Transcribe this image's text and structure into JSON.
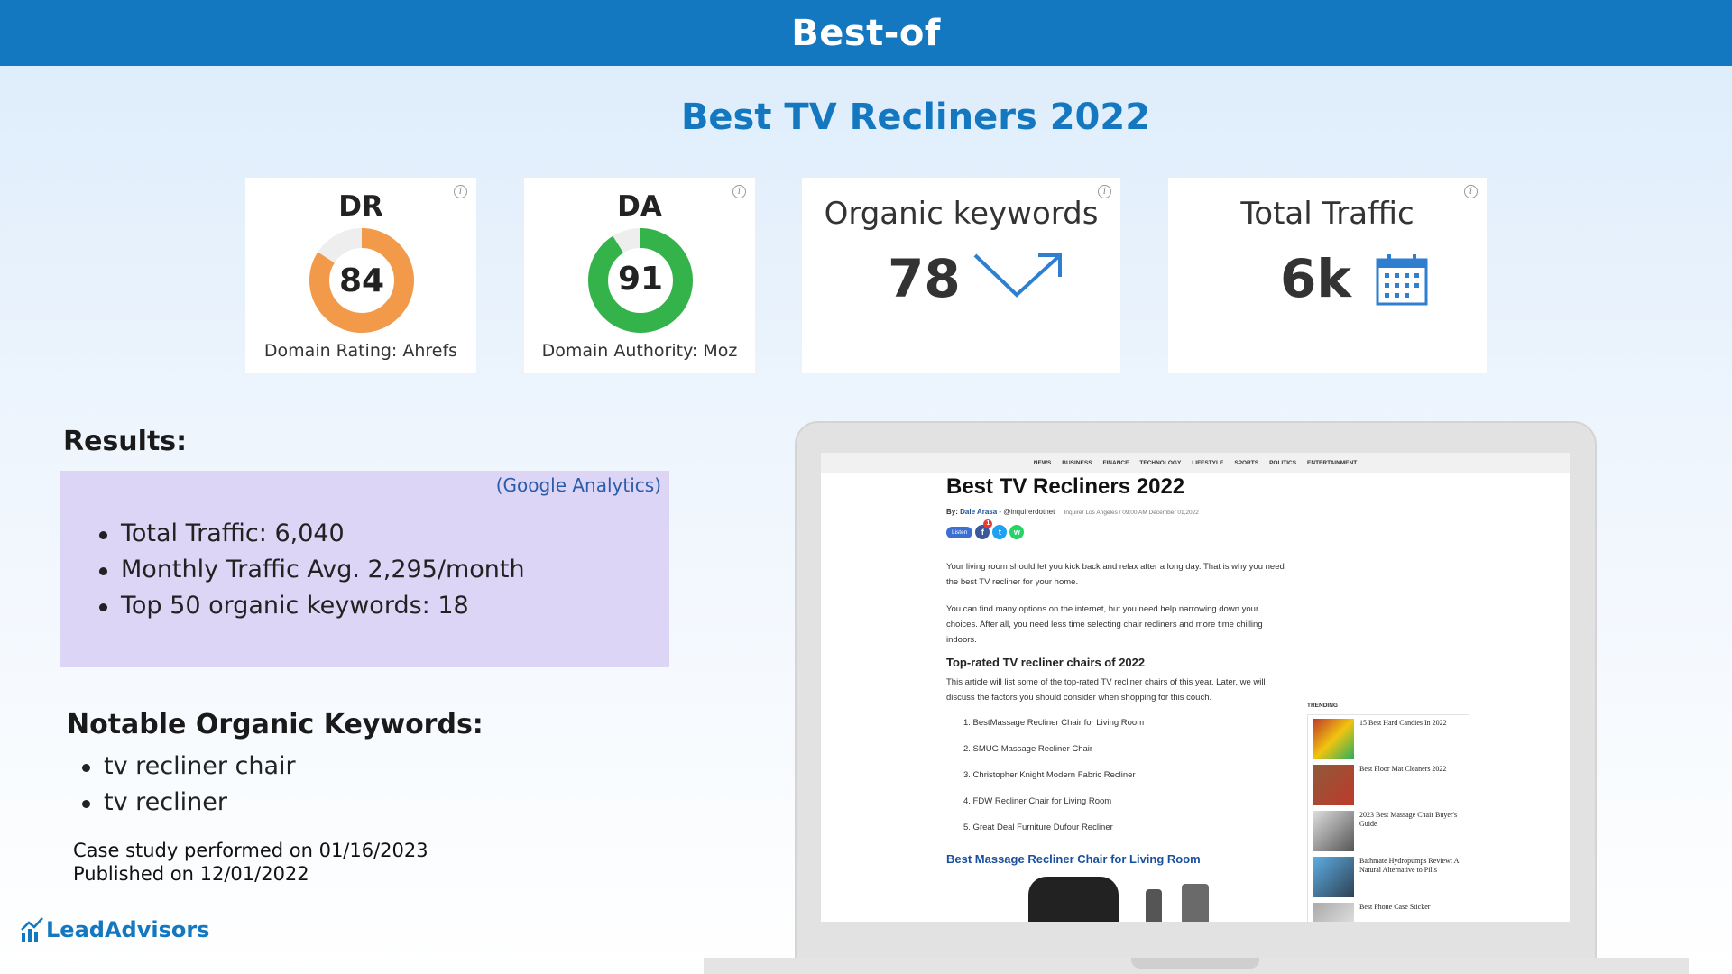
{
  "header": {
    "title": "Best-of"
  },
  "case_title": "Best TV Recliners 2022",
  "metrics": {
    "dr": {
      "label": "DR",
      "value": "84",
      "percent": 84,
      "caption": "Domain Rating: Ahrefs",
      "color": "#f2994a"
    },
    "da": {
      "label": "DA",
      "value": "91",
      "percent": 91,
      "caption": "Domain Authority: Moz",
      "color": "#34b34a"
    },
    "keywords": {
      "label": "Organic keywords",
      "value": "78",
      "icon": "trend-up-icon"
    },
    "traffic": {
      "label": "Total Traffic",
      "value": "6k",
      "icon": "calendar-icon"
    },
    "info_glyph": "i"
  },
  "results": {
    "heading": "Results:",
    "source": "(Google Analytics)",
    "items": [
      "Total Traffic: 6,040",
      "Monthly Traffic Avg. 2,295/month",
      "Top 50 organic keywords: 18"
    ]
  },
  "keywords": {
    "heading": "Notable Organic Keywords:",
    "items": [
      "tv recliner chair",
      "tv recliner"
    ]
  },
  "footnote": {
    "performed": "Case study performed on 01/16/2023",
    "published": "Published on 12/01/2022"
  },
  "logo": {
    "text": "LeadAdvisors"
  },
  "screenshot": {
    "nav": [
      "NEWS",
      "BUSINESS",
      "FINANCE",
      "TECHNOLOGY",
      "LIFESTYLE",
      "SPORTS",
      "POLITICS",
      "ENTERTAINMENT"
    ],
    "title": "Best TV Recliners 2022",
    "by": "By:",
    "author": "Dale Arasa",
    "handle": "- @inquirerdotnet",
    "dateline": "Inquirer Los Angeles / 09:00 AM December 01,2022",
    "listen": "Listen",
    "share_badge": "1",
    "para1": "Your living room should let you kick back and relax after a long day. That is why you need the best TV recliner for your home.",
    "para2": "You can find many options on the internet, but you need help narrowing down your choices. After all, you need less time selecting chair recliners and more time chilling indoors.",
    "subheading": "Top-rated TV recliner chairs of 2022",
    "para3": "This article will list some of the top-rated TV recliner chairs of this year. Later, we will discuss the factors you should consider when shopping for this couch.",
    "list": [
      "1. BestMassage Recliner Chair for Living Room",
      "2. SMUG Massage Recliner Chair",
      "3. Christopher Knight Modern Fabric Recliner",
      "4. FDW Recliner Chair for Living Room",
      "5. Great Deal Furniture Dufour Recliner"
    ],
    "link_heading": "Best Massage Recliner Chair for Living Room",
    "trending": {
      "label": "TRENDING",
      "items": [
        "15 Best Hard Candies In 2022",
        "Best Floor Mat Cleaners 2022",
        "2023 Best Massage Chair Buyer's Guide",
        "Bathmate Hydropumps Review: A Natural Alternative to Pills",
        "Best Phone Case Sticker"
      ]
    }
  }
}
